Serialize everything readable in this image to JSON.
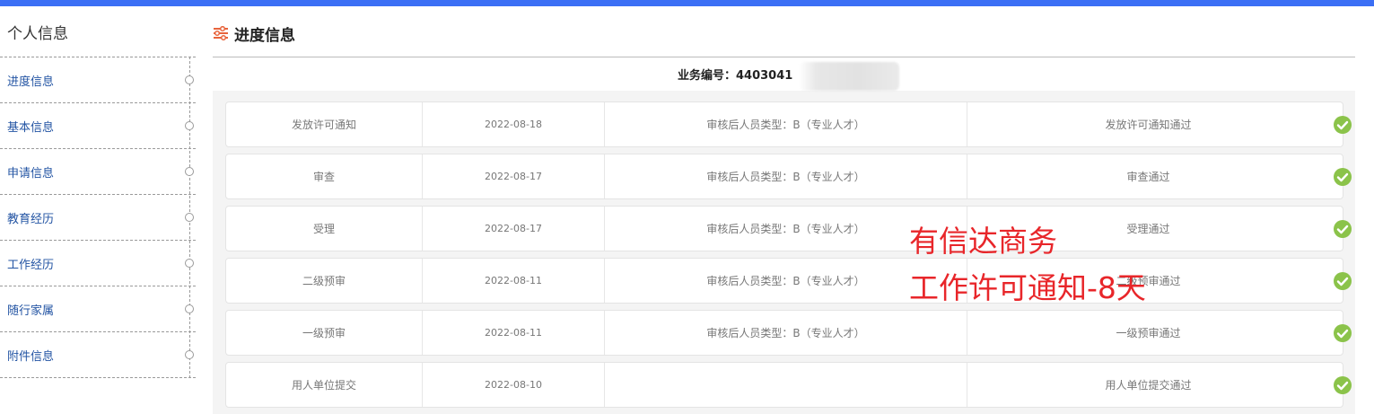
{
  "sidebar": {
    "title": "个人信息",
    "items": [
      {
        "label": "进度信息"
      },
      {
        "label": "基本信息"
      },
      {
        "label": "申请信息"
      },
      {
        "label": "教育经历"
      },
      {
        "label": "工作经历"
      },
      {
        "label": "随行家属"
      },
      {
        "label": "附件信息"
      }
    ]
  },
  "main": {
    "title": "进度信息",
    "title_icon": "sliders-icon",
    "business_no": "业务编号：4403041",
    "rows": [
      {
        "stage": "发放许可通知",
        "date": "2022-08-18",
        "detail": "审核后人员类型：B（专业人才）",
        "result": "发放许可通知通过",
        "status_icon": "check-circle-icon"
      },
      {
        "stage": "审查",
        "date": "2022-08-17",
        "detail": "审核后人员类型：B（专业人才）",
        "result": "审查通过",
        "status_icon": "check-circle-icon"
      },
      {
        "stage": "受理",
        "date": "2022-08-17",
        "detail": "审核后人员类型：B（专业人才）",
        "result": "受理通过",
        "status_icon": "check-circle-icon"
      },
      {
        "stage": "二级预审",
        "date": "2022-08-11",
        "detail": "审核后人员类型：B（专业人才）",
        "result": "二级预审通过",
        "status_icon": "check-circle-icon"
      },
      {
        "stage": "一级预审",
        "date": "2022-08-11",
        "detail": "审核后人员类型：B（专业人才）",
        "result": "一级预审通过",
        "status_icon": "check-circle-icon"
      },
      {
        "stage": "用人单位提交",
        "date": "2022-08-10",
        "detail": "",
        "result": "用人单位提交通过",
        "status_icon": "check-circle-icon"
      }
    ]
  },
  "watermark": {
    "line1": "有信达商务",
    "line2": "工作许可通知-8天"
  },
  "colors": {
    "accent_bar": "#3b6ff5",
    "link": "#2354a3",
    "success": "#8bc34a",
    "watermark": "#e8262a",
    "title_icon": "#e8643c"
  }
}
